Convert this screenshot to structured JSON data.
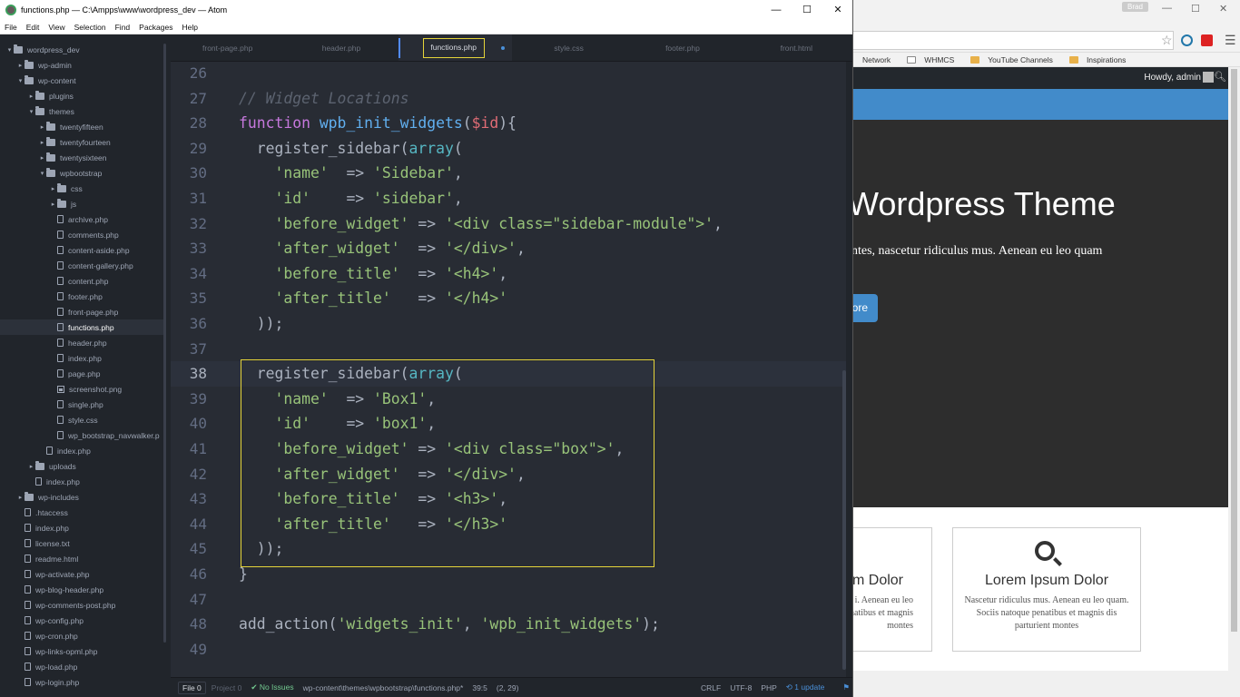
{
  "atom": {
    "window_title": "functions.php — C:\\Ampps\\www\\wordpress_dev — Atom",
    "menu": [
      "File",
      "Edit",
      "View",
      "Selection",
      "Find",
      "Packages",
      "Help"
    ],
    "tree": [
      {
        "label": "wordpress_dev",
        "type": "folder",
        "open": true,
        "depth": 0
      },
      {
        "label": "wp-admin",
        "type": "folder",
        "open": false,
        "depth": 1
      },
      {
        "label": "wp-content",
        "type": "folder",
        "open": true,
        "depth": 1
      },
      {
        "label": "plugins",
        "type": "folder",
        "open": false,
        "depth": 2
      },
      {
        "label": "themes",
        "type": "folder",
        "open": true,
        "depth": 2
      },
      {
        "label": "twentyfifteen",
        "type": "folder",
        "open": false,
        "depth": 3
      },
      {
        "label": "twentyfourteen",
        "type": "folder",
        "open": false,
        "depth": 3
      },
      {
        "label": "twentysixteen",
        "type": "folder",
        "open": false,
        "depth": 3
      },
      {
        "label": "wpbootstrap",
        "type": "folder",
        "open": true,
        "depth": 3
      },
      {
        "label": "css",
        "type": "folder",
        "open": false,
        "depth": 4
      },
      {
        "label": "js",
        "type": "folder",
        "open": false,
        "depth": 4
      },
      {
        "label": "archive.php",
        "type": "file",
        "depth": 4
      },
      {
        "label": "comments.php",
        "type": "file",
        "depth": 4
      },
      {
        "label": "content-aside.php",
        "type": "file",
        "depth": 4
      },
      {
        "label": "content-gallery.php",
        "type": "file",
        "depth": 4
      },
      {
        "label": "content.php",
        "type": "file",
        "depth": 4
      },
      {
        "label": "footer.php",
        "type": "file",
        "depth": 4
      },
      {
        "label": "front-page.php",
        "type": "file",
        "depth": 4
      },
      {
        "label": "functions.php",
        "type": "file",
        "depth": 4,
        "selected": true
      },
      {
        "label": "header.php",
        "type": "file",
        "depth": 4
      },
      {
        "label": "index.php",
        "type": "file",
        "depth": 4
      },
      {
        "label": "page.php",
        "type": "file",
        "depth": 4
      },
      {
        "label": "screenshot.png",
        "type": "image",
        "depth": 4
      },
      {
        "label": "single.php",
        "type": "file",
        "depth": 4
      },
      {
        "label": "style.css",
        "type": "file",
        "depth": 4
      },
      {
        "label": "wp_bootstrap_navwalker.p",
        "type": "file",
        "depth": 4
      },
      {
        "label": "index.php",
        "type": "file",
        "depth": 3
      },
      {
        "label": "uploads",
        "type": "folder",
        "open": false,
        "depth": 2
      },
      {
        "label": "index.php",
        "type": "file",
        "depth": 2
      },
      {
        "label": "wp-includes",
        "type": "folder",
        "open": false,
        "depth": 1
      },
      {
        "label": ".htaccess",
        "type": "file",
        "depth": 1
      },
      {
        "label": "index.php",
        "type": "file",
        "depth": 1
      },
      {
        "label": "license.txt",
        "type": "file",
        "depth": 1
      },
      {
        "label": "readme.html",
        "type": "file",
        "depth": 1
      },
      {
        "label": "wp-activate.php",
        "type": "file",
        "depth": 1
      },
      {
        "label": "wp-blog-header.php",
        "type": "file",
        "depth": 1
      },
      {
        "label": "wp-comments-post.php",
        "type": "file",
        "depth": 1
      },
      {
        "label": "wp-config.php",
        "type": "file",
        "depth": 1
      },
      {
        "label": "wp-cron.php",
        "type": "file",
        "depth": 1
      },
      {
        "label": "wp-links-opml.php",
        "type": "file",
        "depth": 1
      },
      {
        "label": "wp-load.php",
        "type": "file",
        "depth": 1
      },
      {
        "label": "wp-login.php",
        "type": "file",
        "depth": 1
      }
    ],
    "tabs": [
      {
        "label": "front-page.php",
        "active": false
      },
      {
        "label": "header.php",
        "active": false
      },
      {
        "label": "functions.php",
        "active": true,
        "modified": true
      },
      {
        "label": "style.css",
        "active": false
      },
      {
        "label": "footer.php",
        "active": false
      },
      {
        "label": "front.html",
        "active": false
      }
    ],
    "code": [
      {
        "n": "26",
        "t": []
      },
      {
        "n": "27",
        "t": [
          [
            "c",
            "// Widget Locations"
          ]
        ]
      },
      {
        "n": "28",
        "t": [
          [
            "k",
            "function "
          ],
          [
            "f",
            "wpb_init_widgets"
          ],
          [
            "p",
            "("
          ],
          [
            "v",
            "$id"
          ],
          [
            "p",
            "){"
          ]
        ]
      },
      {
        "n": "29",
        "t": [
          [
            "p",
            "  register_sidebar("
          ],
          [
            "a",
            "array"
          ],
          [
            "p",
            "("
          ]
        ]
      },
      {
        "n": "30",
        "t": [
          [
            "p",
            "    "
          ],
          [
            "s",
            "'name'"
          ],
          [
            "p",
            "  => "
          ],
          [
            "s",
            "'Sidebar'"
          ],
          [
            "p",
            ","
          ]
        ]
      },
      {
        "n": "31",
        "t": [
          [
            "p",
            "    "
          ],
          [
            "s",
            "'id'"
          ],
          [
            "p",
            "    => "
          ],
          [
            "s",
            "'sidebar'"
          ],
          [
            "p",
            ","
          ]
        ]
      },
      {
        "n": "32",
        "t": [
          [
            "p",
            "    "
          ],
          [
            "s",
            "'before_widget'"
          ],
          [
            "p",
            " => "
          ],
          [
            "s",
            "'<div class=\"sidebar-module\">'"
          ],
          [
            "p",
            ","
          ]
        ]
      },
      {
        "n": "33",
        "t": [
          [
            "p",
            "    "
          ],
          [
            "s",
            "'after_widget'"
          ],
          [
            "p",
            "  => "
          ],
          [
            "s",
            "'</div>'"
          ],
          [
            "p",
            ","
          ]
        ]
      },
      {
        "n": "34",
        "t": [
          [
            "p",
            "    "
          ],
          [
            "s",
            "'before_title'"
          ],
          [
            "p",
            "  => "
          ],
          [
            "s",
            "'<h4>'"
          ],
          [
            "p",
            ","
          ]
        ]
      },
      {
        "n": "35",
        "t": [
          [
            "p",
            "    "
          ],
          [
            "s",
            "'after_title'"
          ],
          [
            "p",
            "   => "
          ],
          [
            "s",
            "'</h4>'"
          ]
        ]
      },
      {
        "n": "36",
        "t": [
          [
            "p",
            "  ));"
          ]
        ]
      },
      {
        "n": "37",
        "t": []
      },
      {
        "n": "38",
        "t": [
          [
            "p",
            "  register_sidebar("
          ],
          [
            "a",
            "array"
          ],
          [
            "p",
            "("
          ]
        ],
        "current": true
      },
      {
        "n": "39",
        "t": [
          [
            "p",
            "    "
          ],
          [
            "s",
            "'name'"
          ],
          [
            "p",
            "  => "
          ],
          [
            "s",
            "'Box1'"
          ],
          [
            "p",
            ","
          ]
        ]
      },
      {
        "n": "40",
        "t": [
          [
            "p",
            "    "
          ],
          [
            "s",
            "'id'"
          ],
          [
            "p",
            "    => "
          ],
          [
            "s",
            "'box1'"
          ],
          [
            "p",
            ","
          ]
        ]
      },
      {
        "n": "41",
        "t": [
          [
            "p",
            "    "
          ],
          [
            "s",
            "'before_widget'"
          ],
          [
            "p",
            " => "
          ],
          [
            "s",
            "'<div class=\"box\">'"
          ],
          [
            "p",
            ","
          ]
        ]
      },
      {
        "n": "42",
        "t": [
          [
            "p",
            "    "
          ],
          [
            "s",
            "'after_widget'"
          ],
          [
            "p",
            "  => "
          ],
          [
            "s",
            "'</div>'"
          ],
          [
            "p",
            ","
          ]
        ]
      },
      {
        "n": "43",
        "t": [
          [
            "p",
            "    "
          ],
          [
            "s",
            "'before_title'"
          ],
          [
            "p",
            "  => "
          ],
          [
            "s",
            "'<h3>'"
          ],
          [
            "p",
            ","
          ]
        ]
      },
      {
        "n": "44",
        "t": [
          [
            "p",
            "    "
          ],
          [
            "s",
            "'after_title'"
          ],
          [
            "p",
            "   => "
          ],
          [
            "s",
            "'</h3>'"
          ]
        ]
      },
      {
        "n": "45",
        "t": [
          [
            "p",
            "  ));"
          ]
        ]
      },
      {
        "n": "46",
        "t": [
          [
            "p",
            "}"
          ]
        ]
      },
      {
        "n": "47",
        "t": []
      },
      {
        "n": "48",
        "t": [
          [
            "p",
            "add_action("
          ],
          [
            "s",
            "'widgets_init'"
          ],
          [
            "p",
            ", "
          ],
          [
            "s",
            "'wpb_init_widgets'"
          ],
          [
            "p",
            ");"
          ]
        ]
      },
      {
        "n": "49",
        "t": []
      }
    ],
    "status": {
      "file_tab": "File 0",
      "project_tab": "Project 0",
      "issues": "✔ No Issues",
      "path": "wp-content\\themes\\wpbootstrap\\functions.php*",
      "cursor": "39:5",
      "selection": "(2, 29)",
      "line_ending": "CRLF",
      "encoding": "UTF-8",
      "grammar": "PHP",
      "updates": "1 update"
    }
  },
  "browser": {
    "user": "Brad",
    "bookmarks": [
      "Network",
      "WHMCS",
      "YouTube Channels",
      "Inspirations"
    ],
    "admin_bar": {
      "howdy": "Howdy, admin"
    },
    "jumbotron": {
      "heading": "Wordpress Theme",
      "text": "ntes, nascetur ridiculus mus. Aenean eu leo quam",
      "button": "ore"
    },
    "boxes": [
      {
        "title": "m Dolor",
        "text": "i. Aenean eu leo natibus et magnis montes"
      },
      {
        "title": "Lorem Ipsum Dolor",
        "text": "Nascetur ridiculus mus. Aenean eu leo quam. Sociis natoque penatibus et magnis dis parturient montes",
        "icon": "search-icon"
      }
    ]
  },
  "colors": {
    "accent": "#e5d43a",
    "keyword": "#c678dd",
    "function": "#61afef",
    "string": "#98c379",
    "comment": "#5c6370",
    "variable": "#e06c75",
    "nav_blue": "#428bca"
  }
}
